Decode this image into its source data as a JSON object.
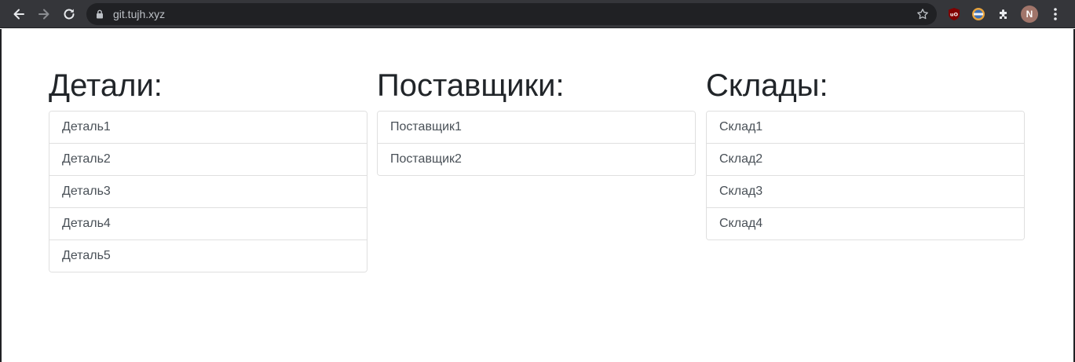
{
  "browser": {
    "url": "git.tujh.xyz",
    "avatar_letter": "N",
    "extensions": [
      "ublock-icon",
      "reader-ext-icon",
      "puzzle-extensions-icon"
    ]
  },
  "columns": [
    {
      "title": "Детали:",
      "items": [
        "Деталь1",
        "Деталь2",
        "Деталь3",
        "Деталь4",
        "Деталь5"
      ]
    },
    {
      "title": "Поставщики:",
      "items": [
        "Поставщик1",
        "Поставщик2"
      ]
    },
    {
      "title": "Склады:",
      "items": [
        "Склад1",
        "Склад2",
        "Склад3",
        "Склад4"
      ]
    }
  ]
}
